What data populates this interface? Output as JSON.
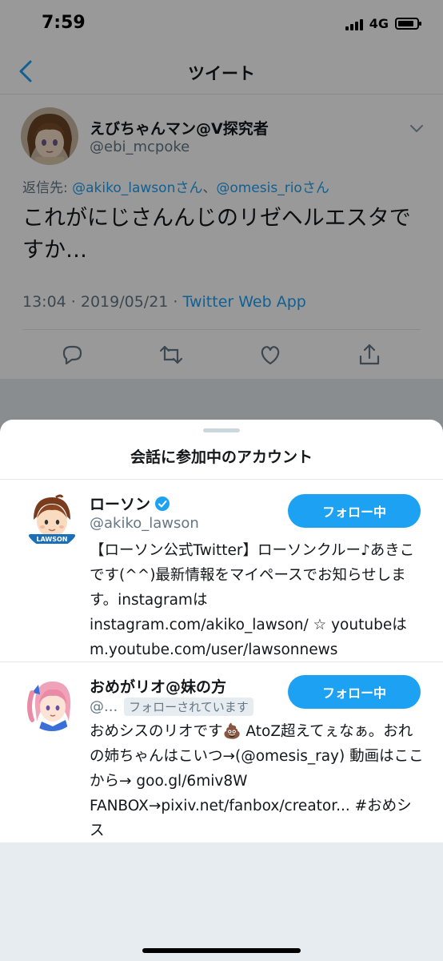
{
  "status_bar": {
    "time": "7:59",
    "network": "4G"
  },
  "nav": {
    "title": "ツイート",
    "back_icon": "chevron-left-icon"
  },
  "tweet": {
    "display_name": "えびちゃんマン@V探究者",
    "handle": "@ebi_mcpoke",
    "reply_prefix": "返信先: ",
    "reply_user1": "@akiko_lawsonさん",
    "reply_sep": "、",
    "reply_user2": "@omesis_rioさん",
    "text": "これがにじさんんじのリゼヘルエスタですか…",
    "timestamp": "13:04 · 2019/05/21 · ",
    "source": "Twitter Web App",
    "actions": [
      "reply-icon",
      "retweet-icon",
      "like-icon",
      "share-icon"
    ]
  },
  "sheet": {
    "title": "会話に参加中のアカウント",
    "accounts": [
      {
        "name": "ローソン",
        "verified": true,
        "handle": "@akiko_lawson",
        "follow_label": "フォロー中",
        "avatar_label": "LAWSON",
        "bio": "【ローソン公式Twitter】ローソンクルー♪あきこです(^^)最新情報をマイペースでお知らせします。instagramは instagram.com/akiko_lawson/ ☆ youtubeは m.youtube.com/user/lawsonnews"
      },
      {
        "name": "おめがリオ@妹の方",
        "handle": "@...",
        "follows_you": "フォローされています",
        "follow_label": "フォロー中",
        "bio": "おめシスのリオです💩 AtoZ超えてぇなぁ。おれの姉ちゃんはこいつ→(@omesis_ray) 動画はここから→ goo.gl/6miv8W FANBOX→pixiv.net/fanbox/creator... #おめシス"
      }
    ]
  },
  "colors": {
    "accent": "#1da1f2",
    "secondary_text": "#657786",
    "divider": "#e1e8ed"
  }
}
